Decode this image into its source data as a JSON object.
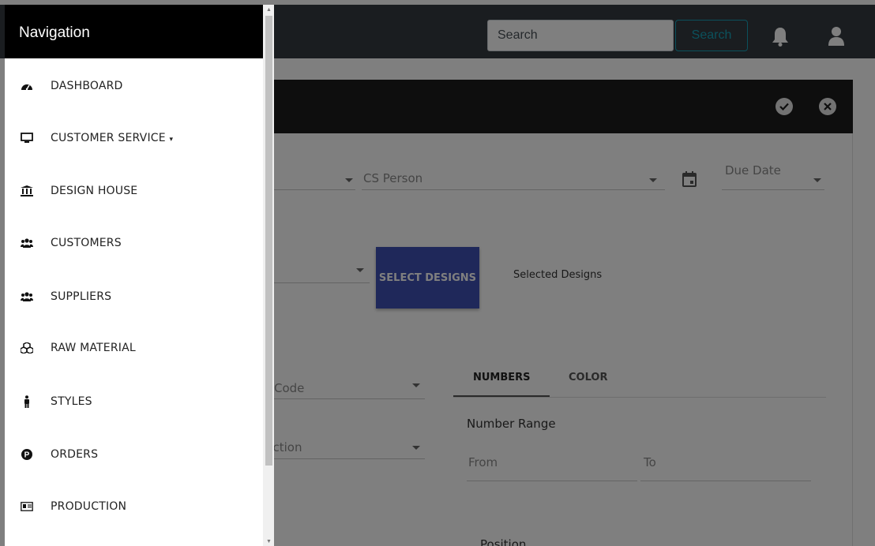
{
  "topbar": {
    "search_placeholder": "Search",
    "search_button": "Search"
  },
  "form": {
    "cs_person": "CS Person",
    "due_date": "Due Date",
    "select_designs": "SELECT DESIGNS",
    "selected_designs": "Selected Designs",
    "code_fragment": "Code",
    "production_fragment": "uction",
    "tabs": [
      "NUMBERS",
      "COLOR"
    ],
    "number_range": "Number Range",
    "from": "From",
    "to": "To",
    "position": "Position"
  },
  "sidebar": {
    "title": "Navigation",
    "items": [
      {
        "label": "DASHBOARD",
        "icon": "tachometer-icon"
      },
      {
        "label": "CUSTOMER SERVICE",
        "icon": "desktop-icon",
        "caret": "▾"
      },
      {
        "label": "DESIGN HOUSE",
        "icon": "university-icon"
      },
      {
        "label": "CUSTOMERS",
        "icon": "users-icon"
      },
      {
        "label": "SUPPLIERS",
        "icon": "users-icon"
      },
      {
        "label": "RAW MATERIAL",
        "icon": "cubes-icon"
      },
      {
        "label": "STYLES",
        "icon": "male-icon"
      },
      {
        "label": "ORDERS",
        "icon": "p-circle-icon"
      },
      {
        "label": "PRODUCTION",
        "icon": "id-card-icon"
      }
    ]
  },
  "colors": {
    "topbar": "#343a40",
    "search_outline": "#17a2b8",
    "primary_button": "#3f51b5"
  }
}
